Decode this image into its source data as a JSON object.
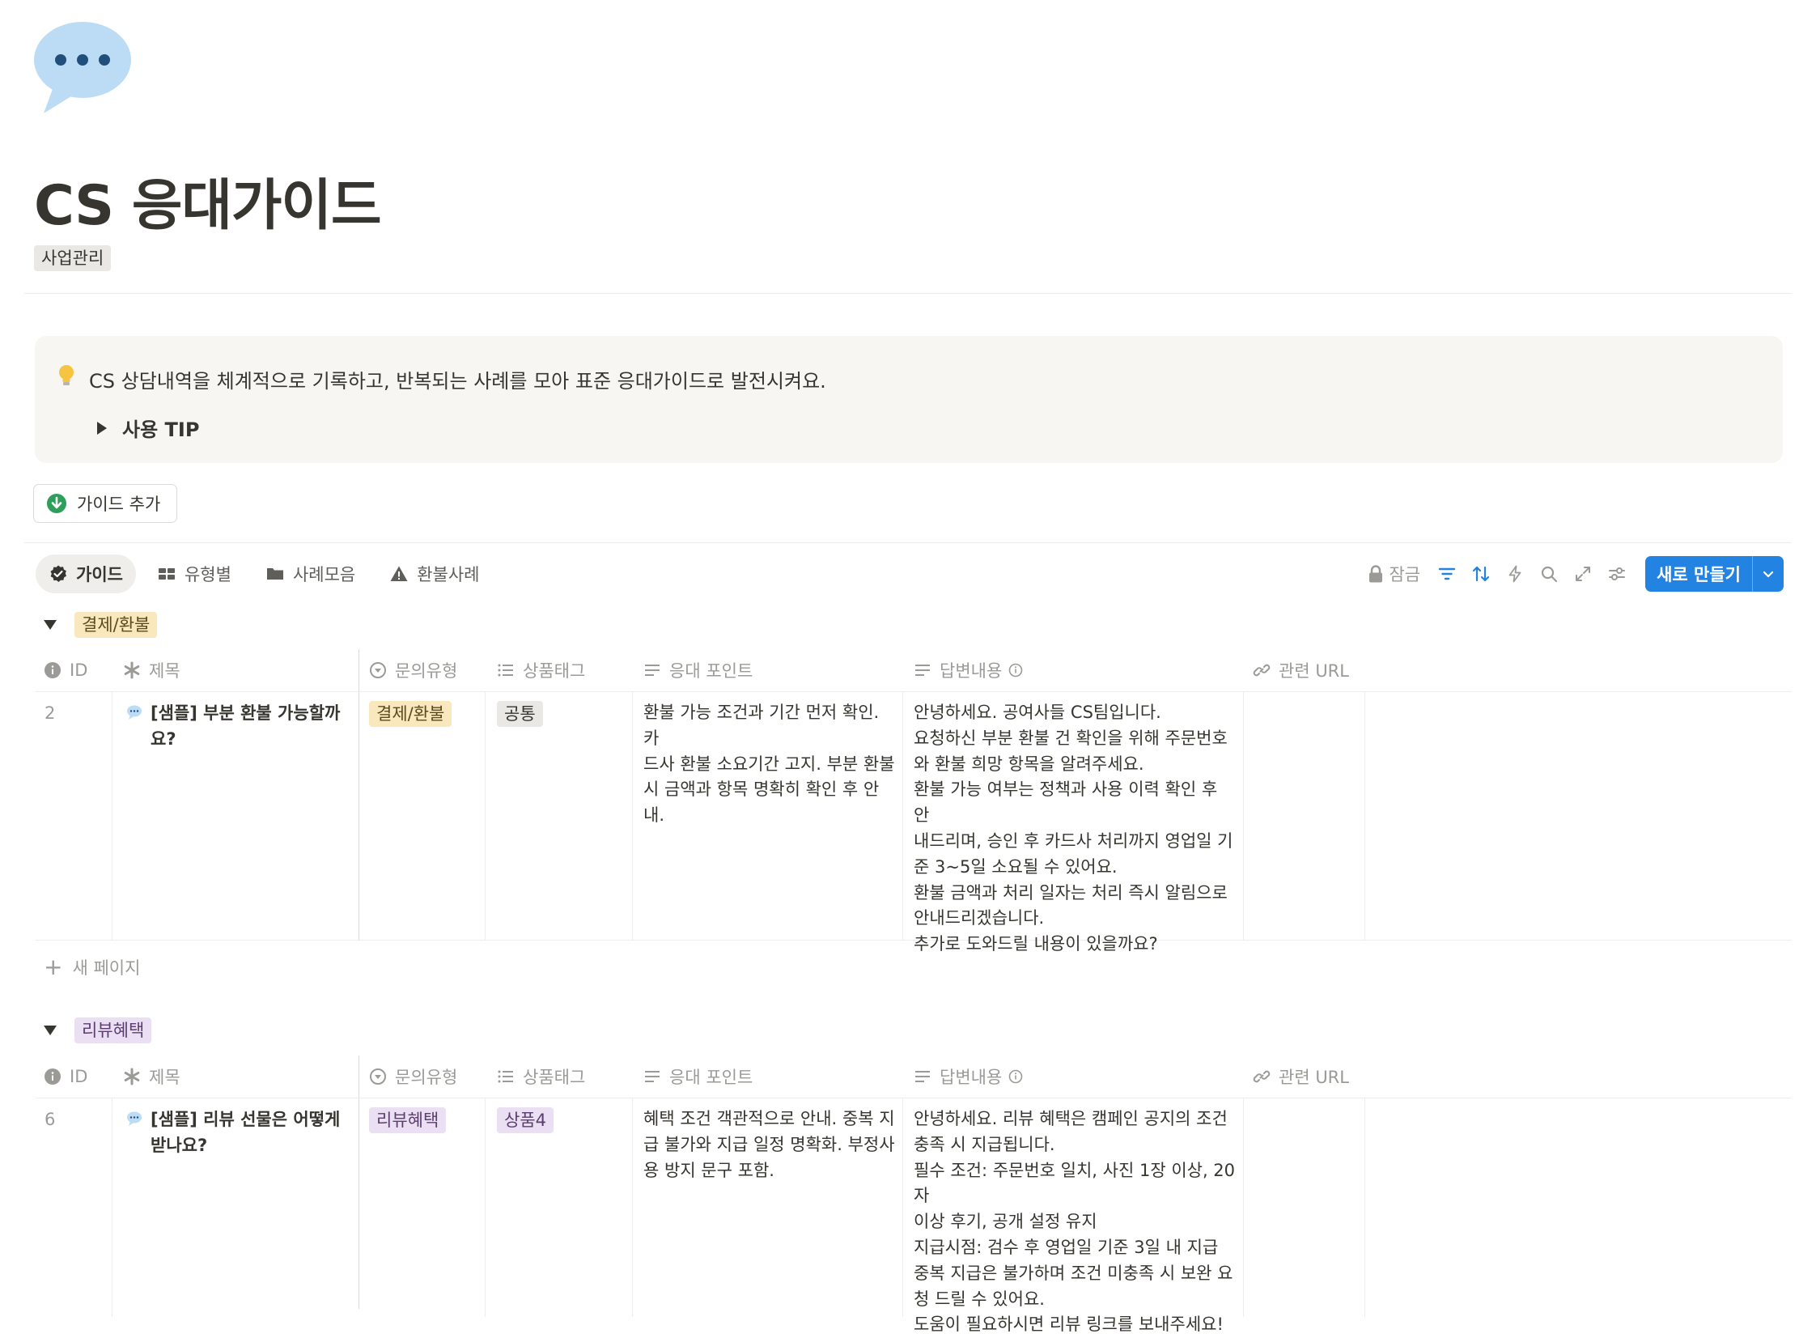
{
  "page": {
    "title": "CS 응대가이드",
    "tag": "사업관리",
    "icon": "speech-bubble-icon"
  },
  "callout": {
    "icon": "lightbulb-icon",
    "text": "CS 상담내역을 체계적으로 기록하고, 반복되는 사례를 모아 표준 응대가이드로 발전시켜요.",
    "toggle_label": "사용 TIP"
  },
  "add_button": {
    "label": "가이드 추가",
    "icon": "arrow-down-circle-icon"
  },
  "views": [
    {
      "label": "가이드",
      "icon": "verified-badge-icon",
      "active": true
    },
    {
      "label": "유형별",
      "icon": "board-icon",
      "active": false
    },
    {
      "label": "사례모음",
      "icon": "folder-icon",
      "active": false
    },
    {
      "label": "환불사례",
      "icon": "warning-icon",
      "active": false
    }
  ],
  "toolbar": {
    "lock_label": "잠금",
    "new_button_label": "새로 만들기"
  },
  "columns": [
    "ID",
    "제목",
    "문의유형",
    "상품태그",
    "응대 포인트",
    "답변내용",
    "관련 URL"
  ],
  "colors": {
    "accent": "#2383e2",
    "yellow_tag_bg": "#f9e8bd",
    "purple_tag_bg": "#ebdff3",
    "gray_tag_bg": "#e9e8e5",
    "add_icon_green": "#2e9e5b"
  },
  "groups": [
    {
      "name": "결제/환불",
      "color": "yellow",
      "new_page_label": "새 페이지",
      "rows": [
        {
          "id": "2",
          "title_lines": [
            "[샘플] 부분 환불 가능할까",
            "요?"
          ],
          "type": "결제/환불",
          "type_color": "yellow",
          "product": "공통",
          "product_color": "gray",
          "point_lines": [
            "환불 가능 조건과 기간 먼저 확인. 카",
            "드사 환불 소요기간 고지. 부분 환불",
            "시 금액과 항목 명확히 확인 후 안내."
          ],
          "answer_lines": [
            "안녕하세요. 공여사들 CS팀입니다.",
            "요청하신 부분 환불 건 확인을 위해 주문번호",
            "와 환불 희망 항목을 알려주세요.",
            "환불 가능 여부는 정책과 사용 이력 확인 후 안",
            "내드리며, 승인 후 카드사 처리까지 영업일 기",
            "준 3~5일 소요될 수 있어요.",
            "환불 금액과 처리 일자는 처리 즉시 알림으로",
            "안내드리겠습니다.",
            "추가로 도와드릴 내용이 있을까요?"
          ]
        }
      ]
    },
    {
      "name": "리뷰혜택",
      "color": "purple",
      "rows": [
        {
          "id": "6",
          "title_lines": [
            "[샘플] 리뷰 선물은 어떻게",
            "받나요?"
          ],
          "type": "리뷰혜택",
          "type_color": "purple",
          "product": "상품4",
          "product_color": "purple",
          "point_lines": [
            "혜택 조건 객관적으로 안내. 중복 지",
            "급 불가와 지급 일정 명확화. 부정사",
            "용 방지 문구 포함."
          ],
          "answer_lines": [
            "안녕하세요. 리뷰 혜택은 캠페인 공지의 조건",
            "충족 시 지급됩니다.",
            "필수 조건: 주문번호 일치, 사진 1장 이상, 20자",
            "이상 후기, 공개 설정 유지",
            "지급시점: 검수 후 영업일 기준 3일 내 지급",
            "중복 지급은 불가하며 조건 미충족 시 보완 요",
            "청 드릴 수 있어요.",
            "도움이 필요하시면 리뷰 링크를 보내주세요!"
          ]
        }
      ]
    }
  ]
}
